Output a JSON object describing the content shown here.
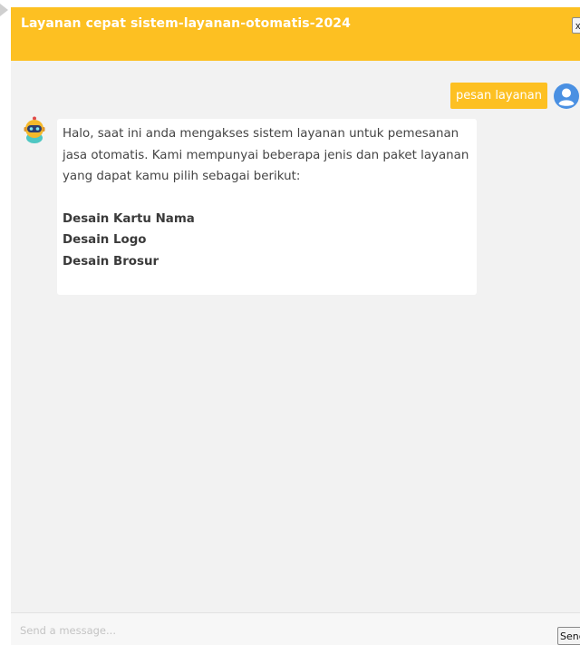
{
  "header": {
    "title": "Layanan cepat sistem-layanan-otomatis-2024",
    "close_label": "x"
  },
  "messages": {
    "user": {
      "text": "pesan layanan",
      "avatar_icon": "user-circle-icon"
    },
    "bot": {
      "avatar_icon": "robot-icon",
      "intro": "Halo, saat ini anda mengakses sistem layanan untuk pemesanan jasa otomatis. Kami mempunyai beberapa jenis dan paket layanan yang dapat kamu pilih sebagai berikut:",
      "services": [
        "Desain Kartu Nama",
        "Desain Logo",
        "Desain Brosur"
      ]
    }
  },
  "input": {
    "placeholder": "Send a message...",
    "value": "",
    "send_label": "Send"
  },
  "colors": {
    "accent": "#fdc022",
    "chat_background": "#f2f2f2",
    "user_avatar": "#4a90e2"
  }
}
